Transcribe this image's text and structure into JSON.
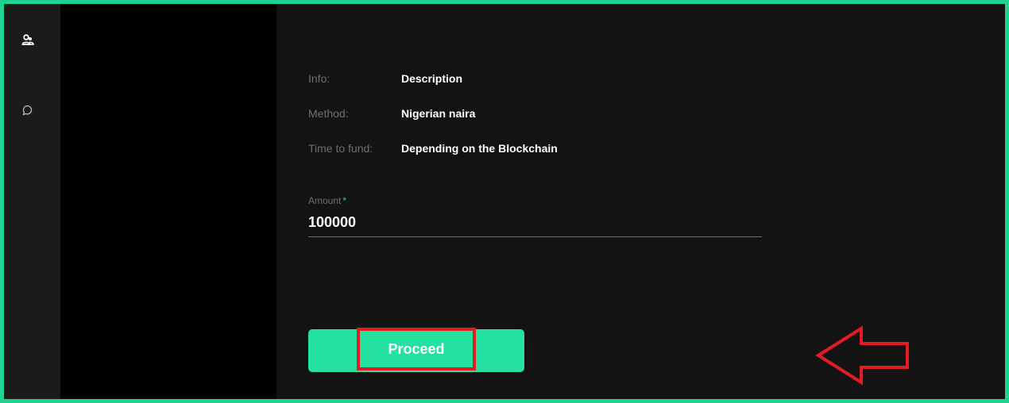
{
  "sidebar": {
    "icons": [
      "user-group-icon",
      "chat-bubble-icon"
    ]
  },
  "details": {
    "info_label": "Info:",
    "info_value": "Description",
    "method_label": "Method:",
    "method_value": "Nigerian naira",
    "time_label": "Time to fund:",
    "time_value": "Depending on the Blockchain"
  },
  "amount": {
    "label": "Amount",
    "required_mark": "*",
    "value": "100000"
  },
  "proceed_label": "Proceed",
  "colors": {
    "accent": "#24e1a0",
    "frame_border": "#1ed38f",
    "annotation": "#e51b24",
    "background": "#131313"
  }
}
